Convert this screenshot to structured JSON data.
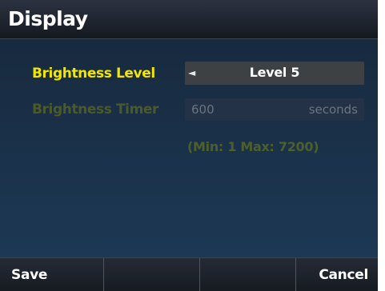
{
  "header": {
    "title": "Display"
  },
  "settings": {
    "brightness_level": {
      "label": "Brightness Level",
      "value": "Level 5",
      "arrow": "◄"
    },
    "brightness_timer": {
      "label": "Brightness Timer",
      "value": "600",
      "unit": "seconds"
    },
    "range_hint": "(Min: 1 Max: 7200)"
  },
  "softkeys": {
    "save": "Save",
    "key2": "",
    "key3": "",
    "cancel": "Cancel"
  },
  "icons": {
    "arrow_left": "left-triangle-icon"
  },
  "colors": {
    "active_label": "#f2e600",
    "disabled_label": "#4a5a2a",
    "background": "#1a3048"
  }
}
